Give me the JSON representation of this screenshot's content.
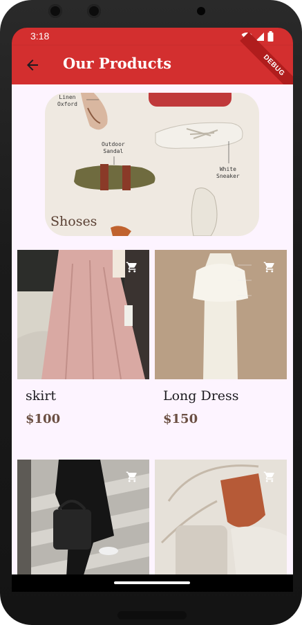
{
  "status": {
    "time": "3:18"
  },
  "appbar": {
    "title": "Our Products",
    "debug_banner": "DEBUG"
  },
  "hero": {
    "label": "Shoses",
    "annotations": {
      "linen": "Linen\nOxford",
      "sandal": "Outdoor\nSandal",
      "sneaker": "White\nSneaker"
    }
  },
  "products": [
    {
      "name": "skirt",
      "price": "$100"
    },
    {
      "name": "Long Dress",
      "price": "$150"
    },
    {
      "name": "",
      "price": ""
    },
    {
      "name": "",
      "price": ""
    }
  ],
  "colors": {
    "accent": "#d32f2f",
    "background": "#fdf4ff",
    "price": "#6b4f43"
  },
  "icons": [
    "back-arrow-icon",
    "wifi-icon",
    "signal-icon",
    "battery-icon",
    "cart-icon"
  ]
}
